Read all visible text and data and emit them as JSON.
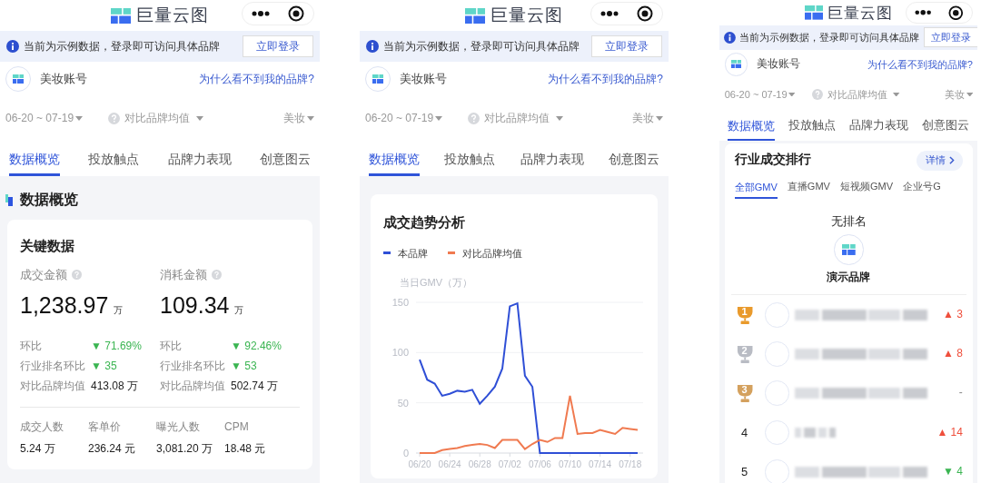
{
  "screens": [
    {
      "kind": "overview",
      "app_title": "巨量云图",
      "notice": {
        "text": "当前为示例数据，登录即可访问具体品牌",
        "button": "立即登录"
      },
      "account": {
        "name": "美妆账号",
        "link": "为什么看不到我的品牌?"
      },
      "filters": {
        "date": "06-20 ~ 07-19",
        "compare": "对比品牌均值",
        "category": "美妆"
      },
      "tabs": [
        {
          "label": "数据概览",
          "selected": true
        },
        {
          "label": "投放触点",
          "selected": false
        },
        {
          "label": "品牌力表现",
          "selected": false
        },
        {
          "label": "创意图云",
          "selected": false
        }
      ],
      "section_title": "数据概览",
      "card": {
        "title": "关键数据",
        "metrics": [
          {
            "label": "成交金额",
            "value": "1,238.97",
            "unit": "万",
            "rows": [
              {
                "label": "环比",
                "kind": "change",
                "value": "▼ 71.69%",
                "color": "#3bb552"
              },
              {
                "label": "行业排名环比",
                "kind": "change",
                "value": "▼ 35",
                "color": "#3bb552"
              },
              {
                "label": "对比品牌均值",
                "kind": "plain",
                "value": "413.08 万"
              }
            ]
          },
          {
            "label": "消耗金额",
            "value": "109.34",
            "unit": "万",
            "rows": [
              {
                "label": "环比",
                "kind": "change",
                "value": "▼ 92.46%",
                "color": "#3bb552"
              },
              {
                "label": "行业排名环比",
                "kind": "change",
                "value": "▼ 53",
                "color": "#3bb552"
              },
              {
                "label": "对比品牌均值",
                "kind": "plain",
                "value": "502.74 万"
              }
            ]
          }
        ],
        "stats": [
          {
            "label": "成交人数",
            "value": "5.24 万"
          },
          {
            "label": "客单价",
            "value": "236.24 元"
          },
          {
            "label": "曝光人数",
            "value": "3,081.20 万"
          },
          {
            "label": "CPM",
            "value": "18.48 元"
          }
        ]
      }
    },
    {
      "kind": "trend",
      "app_title": "巨量云图",
      "notice": {
        "text": "当前为示例数据，登录即可访问具体品牌",
        "button": "立即登录"
      },
      "account": {
        "name": "美妆账号",
        "link": "为什么看不到我的品牌?"
      },
      "filters": {
        "date": "06-20 ~ 07-19",
        "compare": "对比品牌均值",
        "category": "美妆"
      },
      "tabs": [
        {
          "label": "数据概览",
          "selected": true
        },
        {
          "label": "投放触点",
          "selected": false
        },
        {
          "label": "品牌力表现",
          "selected": false
        },
        {
          "label": "创意图云",
          "selected": false
        }
      ],
      "card_title": "成交趋势分析",
      "chart_data": {
        "type": "line",
        "ylabel": "当日GMV（万）",
        "categories": [
          "06/20",
          null,
          null,
          null,
          "06/24",
          null,
          null,
          null,
          "06/28",
          null,
          null,
          null,
          "07/02",
          null,
          null,
          null,
          "07/06",
          null,
          null,
          null,
          "07/10",
          null,
          null,
          null,
          "07/14",
          null,
          null,
          null,
          "07/18",
          null
        ],
        "series": [
          {
            "name": "本品牌",
            "color": "#2f4fd6",
            "values": [
              93,
              73,
              69,
              57,
              59,
              62,
              61,
              63,
              49,
              57,
              66,
              84,
              146,
              149,
              77,
              66,
              0,
              0,
              0,
              0,
              0,
              0,
              0,
              0,
              0,
              0,
              0,
              0,
              0,
              0
            ]
          },
          {
            "name": "对比品牌均值",
            "color": "#f07a50",
            "values": [
              0,
              0,
              0,
              3,
              4,
              5,
              7,
              8,
              9,
              8,
              5,
              13,
              13,
              13,
              4,
              9,
              13,
              11,
              15,
              15,
              57,
              19,
              20,
              20,
              23,
              21,
              19,
              25,
              24,
              23
            ]
          }
        ],
        "yticks": [
          0,
          50,
          100,
          150
        ],
        "ylim": [
          0,
          150
        ]
      }
    },
    {
      "kind": "ranking",
      "app_title": "巨量云图",
      "notice": {
        "text": "当前为示例数据，登录即可访问具体品牌",
        "button": "立即登录"
      },
      "account": {
        "name": "美妆账号",
        "link": "为什么看不到我的品牌?"
      },
      "filters": {
        "date": "06-20 ~ 07-19",
        "compare": "对比品牌均值",
        "category": "美妆"
      },
      "tabs": [
        {
          "label": "数据概览",
          "selected": true
        },
        {
          "label": "投放触点",
          "selected": false
        },
        {
          "label": "品牌力表现",
          "selected": false
        },
        {
          "label": "创意图云",
          "selected": false
        }
      ],
      "card_title": "行业成交排行",
      "detail_button": "详情",
      "sub_tabs": [
        {
          "label": "全部GMV",
          "selected": true
        },
        {
          "label": "直播GMV",
          "selected": false
        },
        {
          "label": "短视频GMV",
          "selected": false
        },
        {
          "label": "企业号G",
          "selected": false
        }
      ],
      "own": {
        "rank_text": "无排名",
        "brand": "演示品牌"
      },
      "rows": [
        {
          "kind": "trophy",
          "rank": "1",
          "color": "#e99a2c",
          "change": {
            "kind": "up",
            "text": "▲ 3"
          }
        },
        {
          "kind": "trophy",
          "rank": "2",
          "color": "#b9bcc4",
          "change": {
            "kind": "up",
            "text": "▲ 8"
          }
        },
        {
          "kind": "trophy",
          "rank": "3",
          "color": "#d4a15e",
          "change": {
            "kind": "flat",
            "text": "-"
          }
        },
        {
          "kind": "number",
          "rank": "4",
          "change": {
            "kind": "up",
            "text": "▲ 14"
          }
        },
        {
          "kind": "number",
          "rank": "5",
          "change": {
            "kind": "down",
            "text": "▼ 4"
          }
        }
      ]
    }
  ]
}
